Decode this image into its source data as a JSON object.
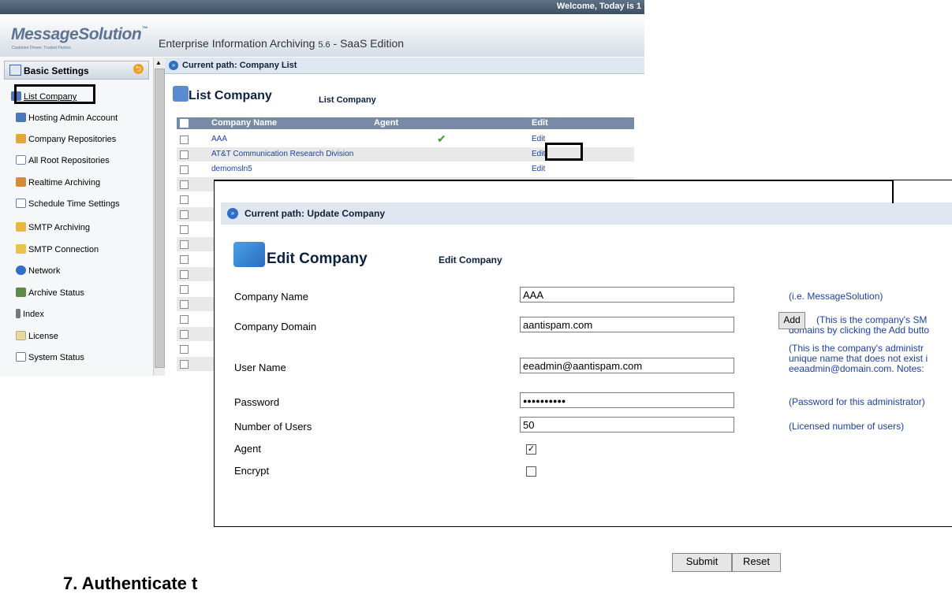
{
  "welcome": "Welcome, Today is 1",
  "logo": {
    "name": "MessageSolution",
    "tm": "™",
    "tagline": "Customer Driven. Trusted Partner."
  },
  "app_title": {
    "main": "Enterprise Information Archiving ",
    "version": "5.6",
    "suffix": " - SaaS Edition"
  },
  "sidebar": {
    "title": "Basic Settings",
    "items": [
      {
        "label": "List Company",
        "icon": "company-icon",
        "color": "#4a78b8"
      },
      {
        "label": "Hosting Admin Account",
        "icon": "admin-icon",
        "color": "#4a78b8"
      },
      {
        "label": "Company Repositories",
        "icon": "repository-icon",
        "color": "#e2a93a"
      },
      {
        "label": "All Root Repositories",
        "icon": "grid-icon",
        "color": "#6e88b0"
      },
      {
        "label": "Realtime Archiving",
        "icon": "archive-icon",
        "color": "#d58b3a"
      },
      {
        "label": "Schedule Time Settings",
        "icon": "calendar-icon",
        "color": "#5b7fb5"
      },
      {
        "label": "SMTP Archiving",
        "icon": "smtp-icon",
        "color": "#e8b73d"
      },
      {
        "label": "SMTP Connection",
        "icon": "connection-icon",
        "color": "#e8c34a"
      },
      {
        "label": "Network",
        "icon": "globe-icon",
        "color": "#2f6ec9"
      },
      {
        "label": "Archive Status",
        "icon": "status-icon",
        "color": "#5c8a4a"
      },
      {
        "label": "Index",
        "icon": "index-icon",
        "color": "#777777"
      },
      {
        "label": "License",
        "icon": "license-icon",
        "color": "#e7d9a0"
      },
      {
        "label": "System Status",
        "icon": "monitor-icon",
        "color": "#6c7c90"
      }
    ]
  },
  "list": {
    "path": "Current path: Company List",
    "heading": "List Company",
    "sub": "List Company",
    "columns": {
      "name": "Company Name",
      "agent": "Agent",
      "edit": "Edit"
    },
    "rows": [
      {
        "name": "AAA",
        "agent": true,
        "edit": "Edit"
      },
      {
        "name": "AT&T Communication Research Division",
        "agent": false,
        "edit": "Edit"
      },
      {
        "name": "demomsln5",
        "agent": false,
        "edit": "Edit"
      }
    ]
  },
  "edit": {
    "path": "Current path: Update Company",
    "heading": "Edit Company",
    "sub": "Edit Company",
    "fields": {
      "company_name": {
        "label": "Company Name",
        "value": "AAA",
        "hint": "(i.e. MessageSolution)"
      },
      "company_domain": {
        "label": "Company Domain",
        "value": "aantispam.com",
        "hint1": "(This is the company's SM",
        "hint2": "domains by clicking the Add butto"
      },
      "user_name": {
        "label": "User Name",
        "value": "eeadmin@aantispam.com",
        "hint1": "(This is the company's administr",
        "hint2": "unique name that does not exist i",
        "hint3": "eeaadmin@domain.com. Notes:"
      },
      "password": {
        "label": "Password",
        "value": "●●●●●●●●●●",
        "hint": "(Password for this administrator)"
      },
      "users": {
        "label": "Number of Users",
        "value": "50",
        "hint": "(Licensed number of users)"
      },
      "agent": {
        "label": "Agent",
        "checked": true
      },
      "encrypt": {
        "label": "Encrypt",
        "checked": false
      }
    },
    "add_label": "Add",
    "submit_label": "Submit",
    "reset_label": "Reset"
  },
  "doc_heading": "7.   Authenticate t"
}
